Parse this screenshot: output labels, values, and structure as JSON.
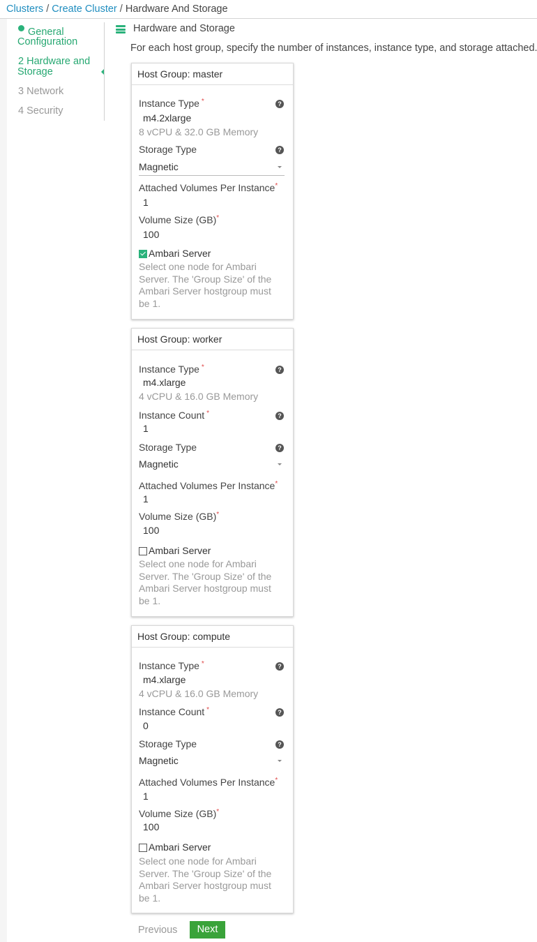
{
  "breadcrumb": {
    "clusters": "Clusters",
    "sep1": " / ",
    "create": "Create Cluster",
    "sep2": " / ",
    "current": "Hardware And Storage"
  },
  "steps": {
    "general": {
      "line1": "General",
      "line2": "Configuration"
    },
    "hardware": {
      "line1": "2 Hardware and",
      "line2": "Storage"
    },
    "network": "3 Network",
    "security": "4 Security"
  },
  "header": {
    "title": "Hardware and Storage",
    "description": "For each host group, specify the number of instances, instance type, and storage attached."
  },
  "labels": {
    "instance_type": "Instance Type",
    "instance_count": "Instance Count",
    "storage_type": "Storage Type",
    "attached_volumes": "Attached Volumes Per Instance",
    "volume_size": "Volume Size (GB)",
    "ambari_server": "Ambari Server",
    "ambari_desc": "Select one node for Ambari Server. The 'Group Size' of the Ambari Server hostgroup must be 1.",
    "required": "*",
    "help": "?"
  },
  "host_groups": [
    {
      "title": "Host Group: master",
      "instance_type": "m4.2xlarge",
      "specs": "8 vCPU & 32.0 GB Memory",
      "storage_type": "Magnetic",
      "attached_volumes": "1",
      "volume_size": "100",
      "ambari_server": true
    },
    {
      "title": "Host Group: worker",
      "instance_type": "m4.xlarge",
      "specs": "4 vCPU & 16.0 GB Memory",
      "instance_count": "1",
      "storage_type": "Magnetic",
      "attached_volumes": "1",
      "volume_size": "100",
      "ambari_server": false
    },
    {
      "title": "Host Group: compute",
      "instance_type": "m4.xlarge",
      "specs": "4 vCPU & 16.0 GB Memory",
      "instance_count": "0",
      "storage_type": "Magnetic",
      "attached_volumes": "1",
      "volume_size": "100",
      "ambari_server": false
    }
  ],
  "buttons": {
    "previous": "Previous",
    "next": "Next"
  },
  "colors": {
    "accent": "#2ab27b",
    "link": "#1f8dbf",
    "next_button": "#3aa33a",
    "required": "#e04a4a"
  }
}
